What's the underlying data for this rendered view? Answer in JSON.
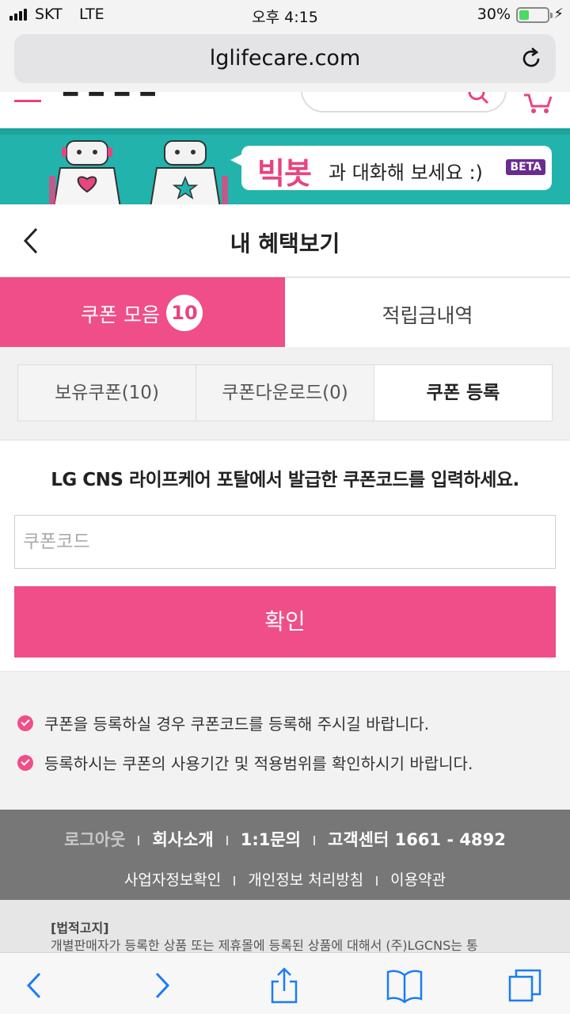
{
  "status_bar": {
    "carrier": "SKT",
    "network": "LTE",
    "time": "오후 4:15",
    "battery_percent": "30%"
  },
  "browser": {
    "url": "lglifecare.com"
  },
  "banner": {
    "brand": "빅봇",
    "message": "과 대화해 보세요 :)",
    "badge": "BETA"
  },
  "page": {
    "title": "내 혜택보기"
  },
  "main_tabs": {
    "coupons_label": "쿠폰 모음",
    "coupons_count": "10",
    "points_label": "적립금내역"
  },
  "sub_tabs": {
    "owned": "보유쿠폰(10)",
    "download": "쿠폰다운로드(0)",
    "register": "쿠폰 등록"
  },
  "register": {
    "instruction": "LG CNS 라이프케어 포탈에서 발급한 쿠폰코드를 입력하세요.",
    "input_placeholder": "쿠폰코드",
    "confirm_label": "확인"
  },
  "notices": [
    "쿠폰을 등록하실 경우 쿠폰코드를 등록해 주시길 바랍니다.",
    "등록하시는 쿠폰의 사용기간 및 적용범위를 확인하시기 바랍니다."
  ],
  "footer": {
    "logout": "로그아웃",
    "company": "회사소개",
    "inquiry": "1:1문의",
    "customer_center": "고객센터 1661 - 4892",
    "business_info": "사업자정보확인",
    "privacy": "개인정보 처리방침",
    "terms": "이용약관"
  },
  "legal": {
    "title": "[법적고지]",
    "text": "개별판매자가 등록한 상품 또는 제휴몰에 등록된 상품에 대해서 (주)LGCNS는 통"
  },
  "colors": {
    "accent": "#ef4e88",
    "banner": "#22b3ad",
    "footer": "#777777"
  }
}
